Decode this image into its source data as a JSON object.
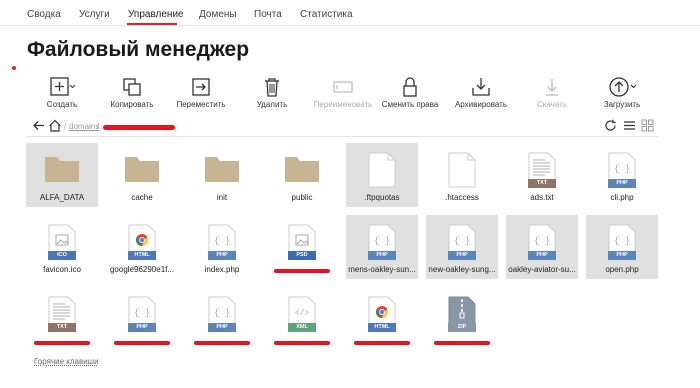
{
  "nav": {
    "tabs": [
      "Сводка",
      "Услуги",
      "Управление",
      "Домены",
      "Почта",
      "Статистика"
    ],
    "active": "Управление",
    "accent": "#e1201f"
  },
  "page": {
    "title": "Файловый менеджер"
  },
  "toolbar": {
    "create": "Создать",
    "copy": "Копировать",
    "move": "Переместить",
    "delete": "Удалить",
    "rename": "Переименовать",
    "chmod": "Сменить права",
    "archive": "Архивировать",
    "download": "Скачать",
    "upload": "Загрузить"
  },
  "path": {
    "root": "domains",
    "sep": "/"
  },
  "files": {
    "alfa": "ALFA_DATA",
    "cache": "cache",
    "init": "init",
    "public": "public",
    "ftpquotas": ".ftpquotas",
    "htaccess": ".htaccess",
    "ads": "ads.txt",
    "cli": "cli.php",
    "favicon": "favicon.ico",
    "google": "google96290e1f...",
    "index": "index.php",
    "mens": "mens-oakley-sun...",
    "newoak": "new-oakley-sung...",
    "aviator": "oakley-aviator-su...",
    "open": "open.php"
  },
  "badges": {
    "txt": "TXT",
    "php": "PHP",
    "ico": "ICO",
    "html": "HTML",
    "psd": "PSD",
    "xml": "XML",
    "zip": "ZIP"
  },
  "colors": {
    "folder": "#c8b392",
    "txt": "#8d7466",
    "php": "#5d84b8",
    "ico": "#4a78b4",
    "html": "#4f79b8",
    "psd": "#3a6db0",
    "xml": "#5fa37c",
    "zip": "#8896a8",
    "redaction": "#e8141c"
  },
  "footer": {
    "hotkeys": "Горячие клавиши"
  }
}
